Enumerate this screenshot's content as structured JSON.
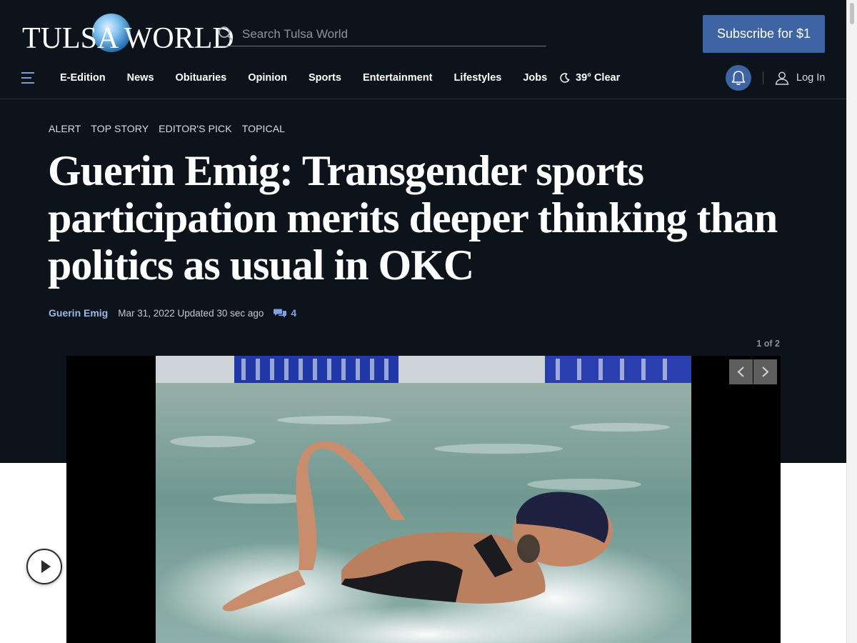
{
  "header": {
    "logo_text": "TULSA WORLD",
    "search": {
      "placeholder": "Search Tulsa World",
      "value": ""
    },
    "subscribe_label": "Subscribe for $1"
  },
  "nav": {
    "items": [
      "E-Edition",
      "News",
      "Obituaries",
      "Opinion",
      "Sports",
      "Entertainment",
      "Lifestyles",
      "Jobs"
    ],
    "weather": "39° Clear",
    "login_label": "Log In"
  },
  "article": {
    "tags": [
      "ALERT",
      "TOP STORY",
      "EDITOR'S PICK",
      "TOPICAL"
    ],
    "headline": "Guerin Emig: Transgender sports participation merits deeper thinking than politics as usual in OKC",
    "author": "Guerin Emig",
    "date": "Mar 31, 2022 Updated 30 sec ago",
    "comment_count": "4"
  },
  "gallery": {
    "counter": "1 of 2"
  },
  "colors": {
    "header_bg": "#0d131b",
    "accent": "#3f64a3",
    "author_link": "#9fb7e3"
  },
  "icons": [
    "menu-icon",
    "search-icon",
    "moon-icon",
    "bell-icon",
    "user-icon",
    "comments-icon",
    "chevron-left-icon",
    "chevron-right-icon",
    "play-icon"
  ]
}
